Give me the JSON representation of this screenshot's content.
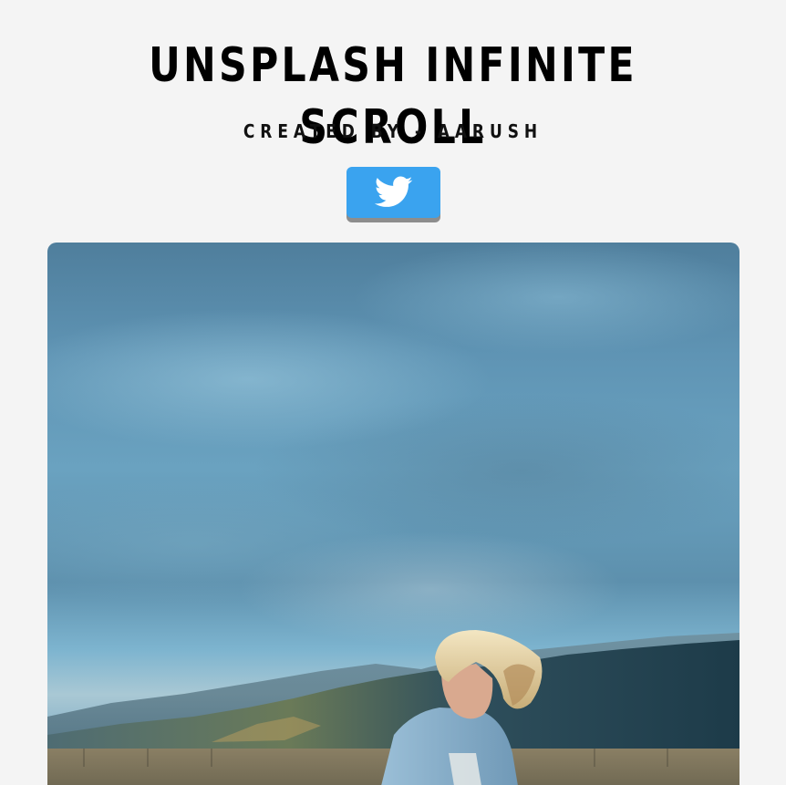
{
  "header": {
    "title": "UNSPLASH INFINITE SCROLL",
    "subtitle": "CREATED BY - AARUSH"
  },
  "twitter_button": {
    "icon": "twitter-bird-icon",
    "color": "#3aa3ef"
  },
  "image": {
    "alt": "Unsplash photo"
  },
  "colors": {
    "background": "#f4f4f4",
    "accent": "#3aa3ef"
  }
}
